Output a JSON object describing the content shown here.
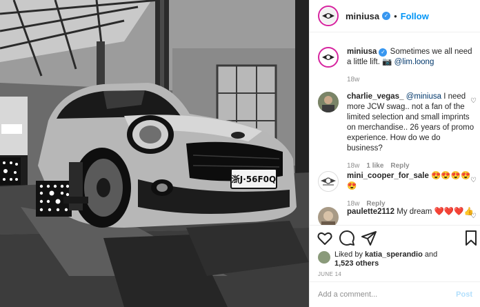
{
  "header": {
    "username": "miniusa",
    "verified_icon": "check",
    "separator": "•",
    "follow_label": "Follow"
  },
  "caption": {
    "username": "miniusa",
    "text_before_mention": " Sometimes we all need a little lift. 📷 ",
    "mention": "@lim.loong",
    "age": "18w"
  },
  "comments": [
    {
      "username": "charlie_vegas_",
      "mention": "@miniusa",
      "text": " I need more JCW swag.. not a fan of the limited selection and small imprints on merchandise.. 26 years of promo experience. How do we do business?",
      "age": "18w",
      "likes": "1 like",
      "reply_label": "Reply"
    },
    {
      "username": "mini_cooper_for_sale",
      "text": " 😍😍😍😍😍",
      "age": "18w",
      "reply_label": "Reply"
    },
    {
      "username": "paulette2112",
      "text": " My dream ❤️❤️❤️👍"
    }
  ],
  "likes": {
    "prefix": "Liked by ",
    "user": "katia_sperandio",
    "middle": " and",
    "count": "1,523 others"
  },
  "date": "JUNE 14",
  "add_comment": {
    "placeholder": "Add a comment...",
    "post_label": "Post"
  },
  "photo": {
    "plate_text": "浙J·56F0Q"
  },
  "colors": {
    "accent": "#0095f6",
    "verified": "#3897f0",
    "like_red": "#ed4956",
    "muted": "#8e8e8e"
  }
}
